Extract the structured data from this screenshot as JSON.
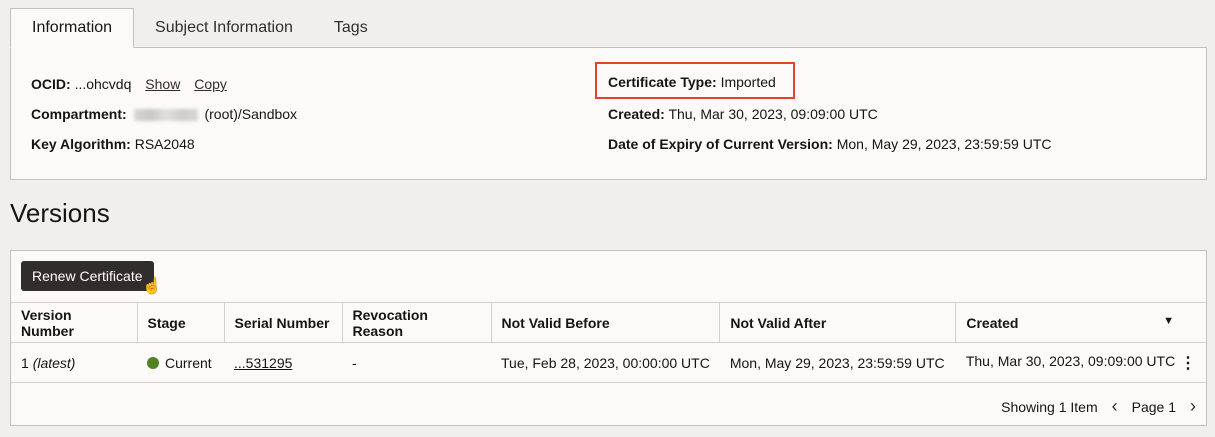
{
  "tabs": [
    {
      "label": "Information"
    },
    {
      "label": "Subject Information"
    },
    {
      "label": "Tags"
    }
  ],
  "info": {
    "ocid_label": "OCID:",
    "ocid_value": "...ohcvdq",
    "show_link": "Show",
    "copy_link": "Copy",
    "compartment_label": "Compartment:",
    "compartment_value": "(root)/Sandbox",
    "key_algorithm_label": "Key Algorithm:",
    "key_algorithm_value": "RSA2048",
    "cert_type_label": "Certificate Type:",
    "cert_type_value": "Imported",
    "created_label": "Created:",
    "created_value": "Thu, Mar 30, 2023, 09:09:00 UTC",
    "expiry_label": "Date of Expiry of Current Version:",
    "expiry_value": "Mon, May 29, 2023, 23:59:59 UTC"
  },
  "versions": {
    "title": "Versions",
    "renew_button": "Renew Certificate",
    "columns": [
      "Version Number",
      "Stage",
      "Serial Number",
      "Revocation Reason",
      "Not Valid Before",
      "Not Valid After",
      "Created"
    ],
    "rows": [
      {
        "version": "1",
        "version_tag": "(latest)",
        "stage": "Current",
        "serial": "...531295",
        "revocation": "-",
        "not_before": "Tue, Feb 28, 2023, 00:00:00 UTC",
        "not_after": "Mon, May 29, 2023, 23:59:59 UTC",
        "created": "Thu, Mar 30, 2023, 09:09:00 UTC"
      }
    ],
    "footer_count": "Showing 1 Item",
    "page_label": "Page 1"
  },
  "colors": {
    "stage_current": "#508223",
    "highlight_border": "#e24329",
    "button_bg": "#312d2a"
  }
}
